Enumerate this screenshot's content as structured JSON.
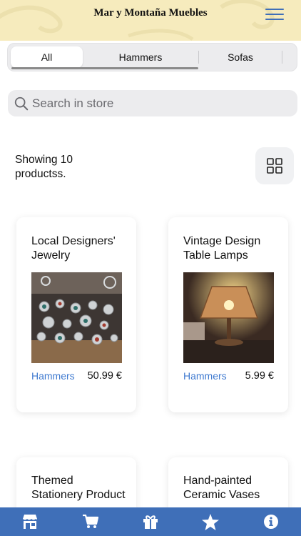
{
  "header": {
    "title": "Mar y Montaña Muebles"
  },
  "tabs": [
    {
      "label": "All",
      "selected": true
    },
    {
      "label": "Hammers",
      "selected": false
    },
    {
      "label": "Sofas",
      "selected": false
    }
  ],
  "search": {
    "placeholder": "Search in store"
  },
  "listing": {
    "count_text": "Showing 10 productss."
  },
  "products": [
    {
      "name": "Local Designers' Jewelry",
      "category": "Hammers",
      "price": "50.99 €"
    },
    {
      "name": "Vintage Design Table Lamps",
      "category": "Hammers",
      "price": "5.99 €"
    },
    {
      "name": "Themed Stationery Product",
      "category": "",
      "price": ""
    },
    {
      "name": "Hand-painted Ceramic Vases",
      "category": "",
      "price": ""
    }
  ],
  "bottom_nav": [
    {
      "icon": "store-icon"
    },
    {
      "icon": "cart-icon"
    },
    {
      "icon": "gift-icon"
    },
    {
      "icon": "star-icon"
    },
    {
      "icon": "info-icon"
    }
  ],
  "colors": {
    "header_bg": "#f6ebbd",
    "accent": "#3f6fb8",
    "category_link": "#3f7ad0"
  }
}
